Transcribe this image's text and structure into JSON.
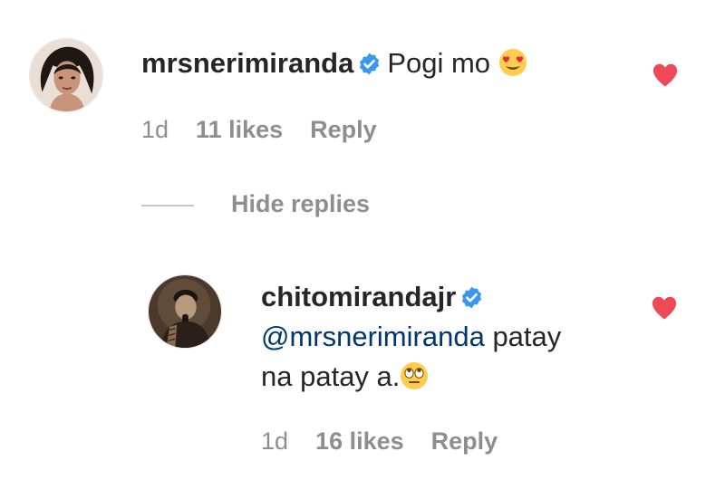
{
  "comment": {
    "username": "mrsnerimiranda",
    "text": "Pogi mo",
    "emoji": "heart-eyes-emoji",
    "time": "1d",
    "likes": "11 likes",
    "reply_label": "Reply"
  },
  "hide_replies": "Hide replies",
  "reply": {
    "username": "chitomirandajr",
    "mention": "@mrsnerimiranda",
    "text_after_mention": "patay",
    "text_line2": "na patay a.",
    "emoji": "eye-roll-emoji",
    "time": "1d",
    "likes": "16 likes",
    "reply_label": "Reply"
  },
  "colors": {
    "heart": "#ed4956",
    "verified": "#3897f0",
    "muted": "#8e8e8e",
    "mention": "#00376b",
    "text": "#262626"
  },
  "icons": {
    "verified": "verified-badge-icon",
    "like": "heart-icon"
  }
}
